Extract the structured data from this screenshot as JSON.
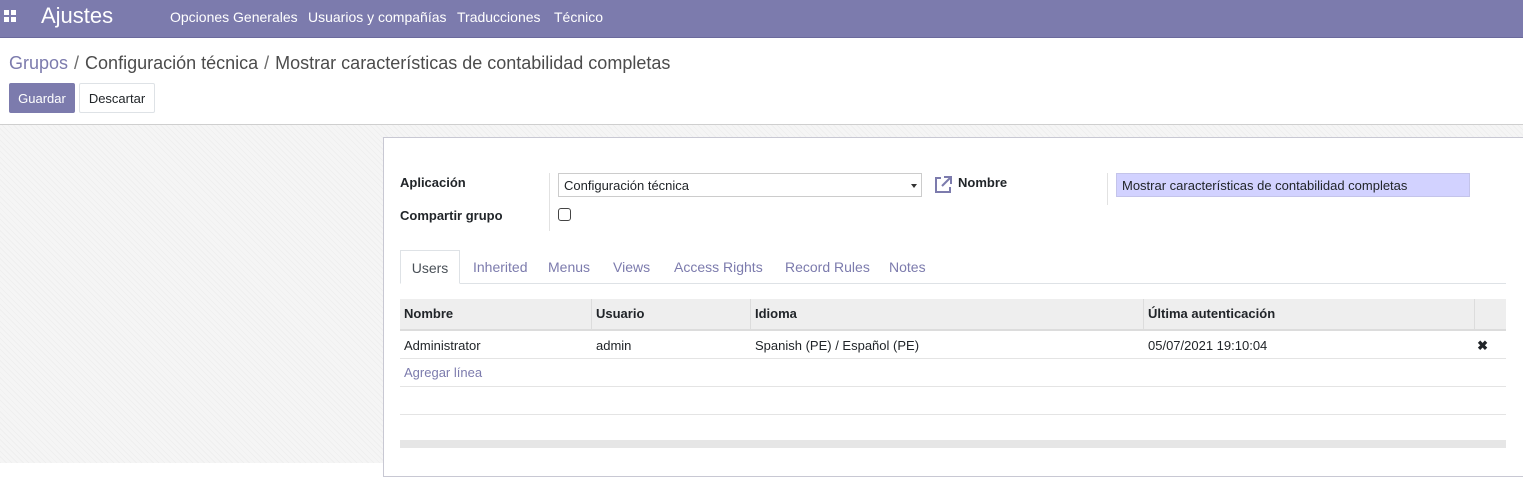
{
  "navbar": {
    "app_title": "Ajustes",
    "menu": [
      "Opciones Generales",
      "Usuarios y compañías",
      "Traducciones",
      "Técnico"
    ]
  },
  "breadcrumb": {
    "items": [
      "Grupos",
      "Configuración técnica",
      "Mostrar características de contabilidad completas"
    ]
  },
  "buttons": {
    "save": "Guardar",
    "discard": "Descartar"
  },
  "form": {
    "application_label": "Aplicación",
    "application_value": "Configuración técnica",
    "name_label": "Nombre",
    "name_value": "Mostrar características de contabilidad completas",
    "share_label": "Compartir grupo",
    "share_checked": false
  },
  "tabs": [
    "Users",
    "Inherited",
    "Menus",
    "Views",
    "Access Rights",
    "Record Rules",
    "Notes"
  ],
  "active_tab": "Users",
  "table": {
    "columns": [
      "Nombre",
      "Usuario",
      "Idioma",
      "Última autenticación"
    ],
    "rows": [
      [
        "Administrator",
        "admin",
        "Spanish (PE) / Español (PE)",
        "05/07/2021 19:10:04"
      ]
    ],
    "add_line": "Agregar línea"
  },
  "icons": {
    "apps": "apps-grid-icon",
    "external_link": "external-link-icon",
    "delete": "delete-row-icon",
    "dropdown": "caret-down-icon"
  },
  "colors": {
    "brand": "#7c7bad",
    "name_field_bg": "#d2d2ff"
  }
}
